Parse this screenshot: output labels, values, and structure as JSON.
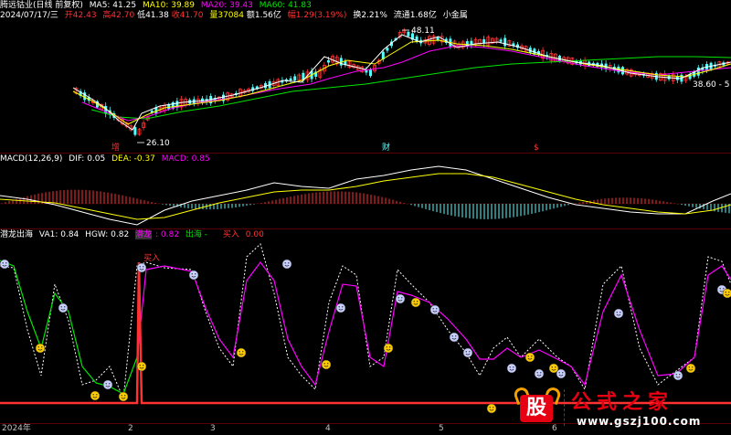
{
  "price_header": {
    "stock_name": "腾远钴业(日线 前复权)",
    "ma5": "MA5: 41.25",
    "ma10": "MA10: 39.89",
    "ma20": "MA20: 39.43",
    "ma60": "MA60: 41.83"
  },
  "quote_line": {
    "date": "2024/07/17/三",
    "open": "开42.43",
    "high": "高42.70",
    "low": "低41.38",
    "close": "收41.70",
    "volume": "量37084",
    "amount": "额1.56亿",
    "change": "幅1.29(3.19%)",
    "turnover": "换2.21%",
    "float": "流通1.68亿",
    "tag": "小金属"
  },
  "price_marks": {
    "high": "48.11",
    "low": "26.10",
    "right": "38.60 - 5",
    "event1": "增",
    "event2": "财",
    "event3": "$"
  },
  "macd_header": {
    "name": "MACD(12,26,9)",
    "dif": "DIF: 0.05",
    "dea": "DEA: -0.37",
    "macd": "MACD: 0.85"
  },
  "ind_header": {
    "name": "潜龙出海",
    "va1": "VA1: 0.84",
    "hgw": "HGW: 0.82",
    "qianlong_label": "潜龙",
    "qianlong_value": ": 0.82",
    "chuhai": "出海 -",
    "buy": "买入",
    "buy_value": "0.00",
    "buy_mark": "买入"
  },
  "axis": {
    "labels": [
      "2024年",
      "2",
      "3",
      "4",
      "5",
      "6"
    ]
  },
  "watermark": {
    "logo_char": "股",
    "title": "公式之家",
    "url": "www.gszj100.com"
  },
  "colors": {
    "up": "#ff3232",
    "down": "#54ffff",
    "ma5": "#ffffff",
    "ma10": "#ffff00",
    "ma20": "#ff00ff",
    "ma60": "#00e600"
  }
}
